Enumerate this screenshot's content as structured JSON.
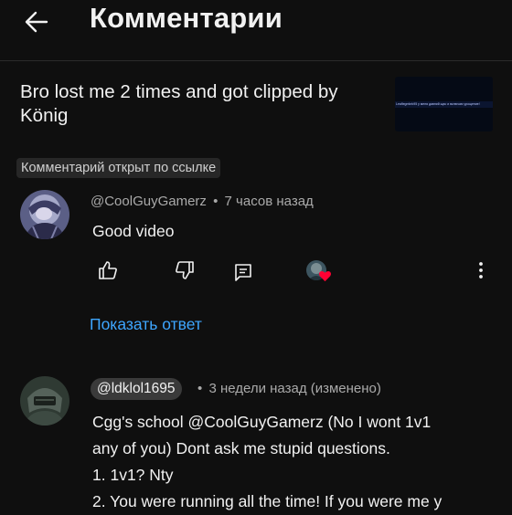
{
  "header": {
    "title": "Комментарии",
    "back_icon": "arrow-left-icon"
  },
  "video": {
    "title": "Bro lost me 2 times and got clipped by König",
    "thumbnail_text": "Leaflegmbrk95 у меня давний щас и включаю урощение!"
  },
  "linked_comment_badge": "Комментарий открыт по ссылке",
  "comments": [
    {
      "author": "@CoolGuyGamerz",
      "separator": "•",
      "time": "7 часов назад",
      "text": "Good video",
      "actions": {
        "like_icon": "thumbs-up-icon",
        "dislike_icon": "thumbs-down-icon",
        "reply_icon": "comment-reply-icon",
        "creator_heart_icon": "creator-heart-icon",
        "more_icon": "more-vert-icon"
      },
      "show_reply_label": "Показать ответ"
    },
    {
      "author": "@ldklol1695",
      "separator": "•",
      "time": "3 недели назад (изменено)",
      "lines": [
        "Cgg's school @CoolGuyGamerz  (No I wont 1v1",
        "any of you) Dont ask me stupid questions.",
        "1. 1v1? Nty",
        "2. You were running all the time! If you were me y"
      ]
    }
  ],
  "colors": {
    "background": "#0f0f0f",
    "text": "#f1f1f1",
    "secondary_text": "#aaaaaa",
    "link": "#3ea6ff",
    "heart": "#ff0033"
  }
}
